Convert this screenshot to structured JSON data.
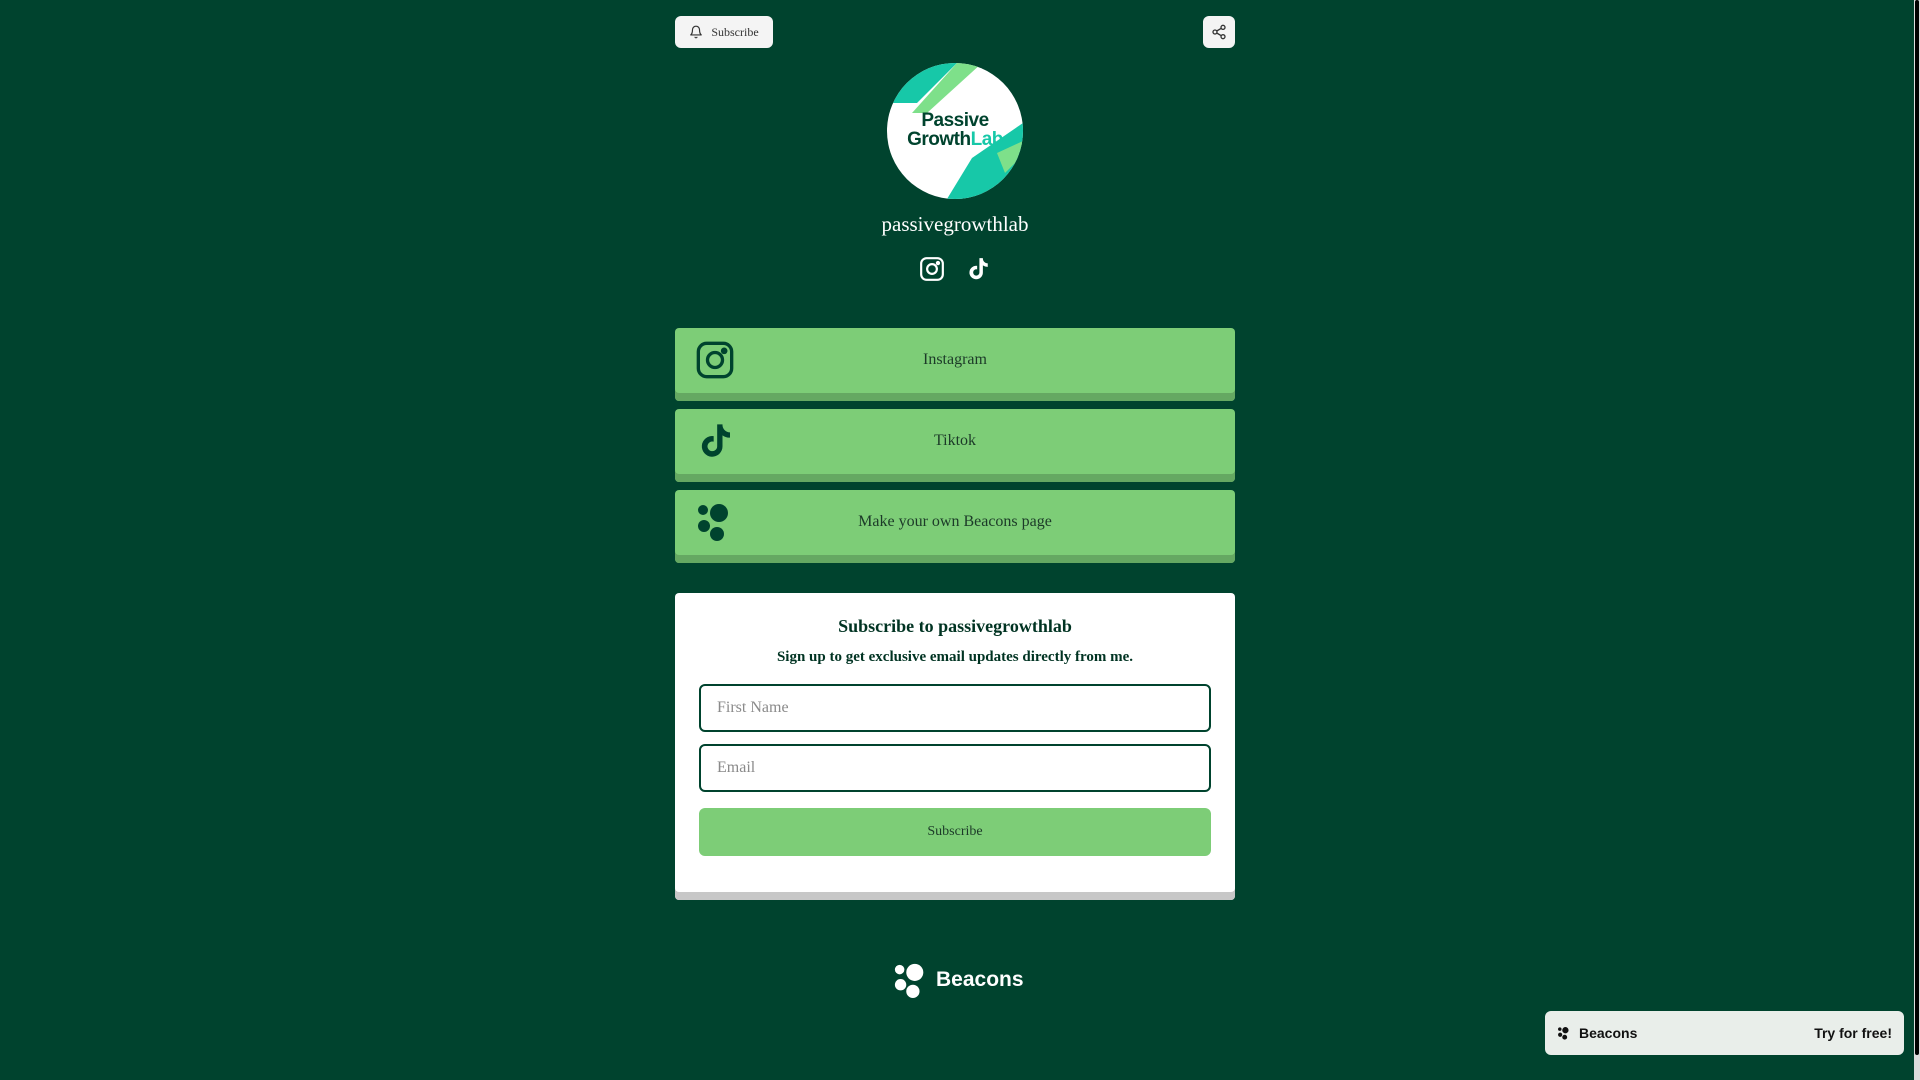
{
  "header": {
    "subscribe_label": "Subscribe"
  },
  "profile": {
    "avatar_line1": "Passive",
    "avatar_line2a": "Growth",
    "avatar_line2b": "Lab",
    "name": "passivegrowthlab"
  },
  "links": [
    {
      "label": "Instagram",
      "icon": "instagram-icon"
    },
    {
      "label": "Tiktok",
      "icon": "tiktok-icon"
    },
    {
      "label": "Make your own Beacons page",
      "icon": "beacons-icon"
    }
  ],
  "subscribe_card": {
    "title": "Subscribe to passivegrowthlab",
    "subtitle": "Sign up to get exclusive email updates directly from me.",
    "first_name_placeholder": "First Name",
    "email_placeholder": "Email",
    "submit_label": "Subscribe"
  },
  "footer": {
    "brand": "Beacons"
  },
  "promo": {
    "brand": "Beacons",
    "cta": "Try for free!"
  },
  "colors": {
    "background": "#00432e",
    "button": "#7dcd77",
    "accent": "#17c8a8"
  }
}
